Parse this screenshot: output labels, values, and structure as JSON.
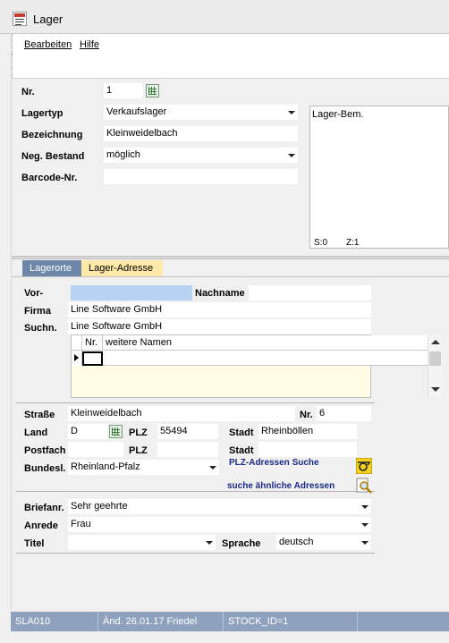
{
  "window": {
    "title": "Lager"
  },
  "menu": {
    "items": [
      "Bearbeiten",
      "Hilfe"
    ]
  },
  "form": {
    "nr_label": "Nr.",
    "nr_value": "1",
    "lagertyp_label": "Lagertyp",
    "lagertyp_value": "Verkaufslager",
    "bezeichnung_label": "Bezeichnung",
    "bezeichnung_value": "Kleinweidelbach",
    "negbestand_label": "Neg. Bestand",
    "negbestand_value": "möglich",
    "barcode_label": "Barcode-Nr.",
    "barcode_value": ""
  },
  "remarks": {
    "title": "Lager-Bem.",
    "status_s": "S:0",
    "status_z": "Z:1"
  },
  "tabs": [
    {
      "label": "Lagerorte",
      "active": false
    },
    {
      "label": "Lager-Adresse",
      "active": true
    }
  ],
  "address": {
    "vorname_label": "Vor-",
    "vorname_value": "",
    "nachname_label": "Nachname",
    "nachname_value": "",
    "firma_label": "Firma",
    "firma_value": "Line Software GmbH",
    "suchn_label": "Suchn.",
    "suchn_value": "Line Software GmbH",
    "grid_col_nr": "Nr.",
    "grid_col_names": "weitere Namen",
    "strasse_label": "Straße",
    "strasse_value": "Kleinweidelbach",
    "hausnr_label": "Nr.",
    "hausnr_value": "6",
    "land_label": "Land",
    "land_value": "D",
    "plz_label": "PLZ",
    "plz_value": "55494",
    "stadt_label": "Stadt",
    "stadt_value": "Rheinböllen",
    "postfach_label": "Postfach",
    "postfach_value": "",
    "plz2_label": "PLZ",
    "plz2_value": "",
    "stadt2_label": "Stadt",
    "stadt2_value": "",
    "bundesl_label": "Bundesl.",
    "bundesl_value": "Rheinland-Pfalz",
    "plz_search_link": "PLZ-Adressen Suche",
    "similar_search_link": "suche ähnliche Adressen"
  },
  "salutation": {
    "briefanr_label": "Briefanr.",
    "briefanr_value": "Sehr geehrte",
    "anrede_label": "Anrede",
    "anrede_value": "Frau",
    "titel_label": "Titel",
    "titel_value": "",
    "sprache_label": "Sprache",
    "sprache_value": "deutsch"
  },
  "status": {
    "code": "SLA010",
    "changed": "Änd. 26.01.17 Friedel",
    "record": "STOCK_ID=1"
  },
  "colors": {
    "status_bar": "#8ea2bd",
    "tab_active": "#ffe9a8",
    "tab_inactive": "#6e86a8",
    "vorname_field": "#b7d3f2",
    "grid_bg": "#fffde6"
  }
}
